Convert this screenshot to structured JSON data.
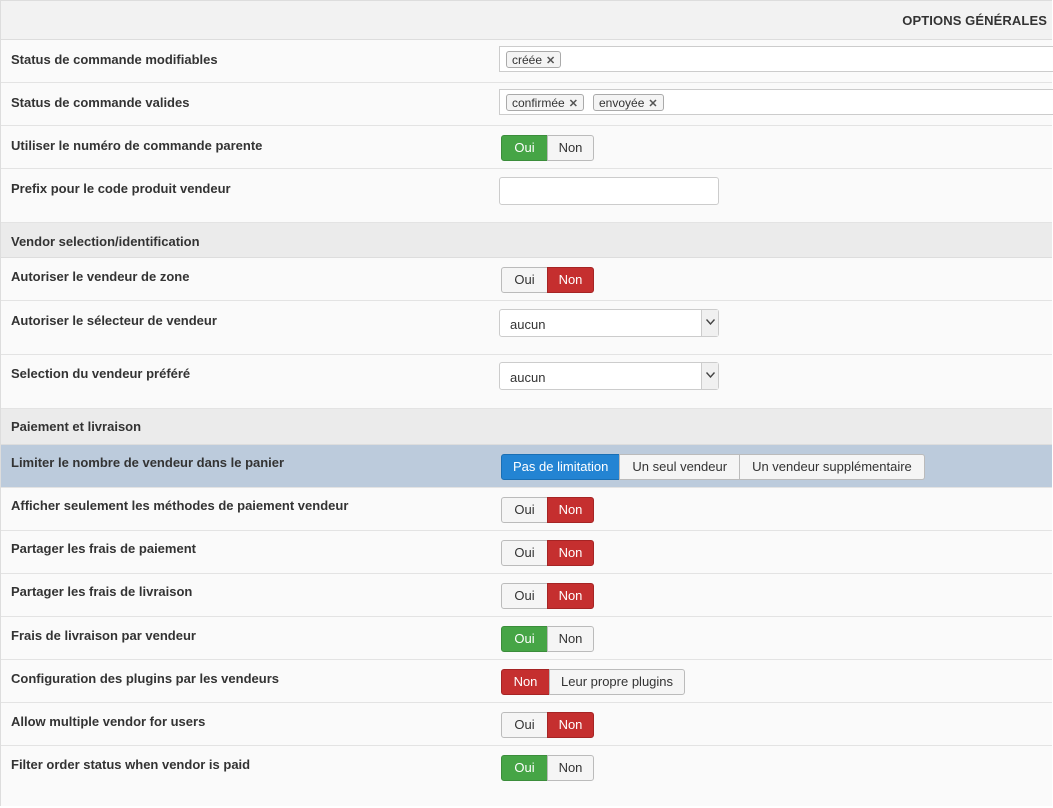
{
  "header": {
    "title": "OPTIONS GÉNÉRALES"
  },
  "rows": {
    "status_modifiables": {
      "label": "Status de commande modifiables",
      "tags": [
        "créée"
      ]
    },
    "status_valides": {
      "label": "Status de commande valides",
      "tags": [
        "confirmée",
        "envoyée"
      ]
    },
    "numero_parente": {
      "label": "Utiliser le numéro de commande parente",
      "oui": "Oui",
      "non": "Non",
      "selected": "Oui"
    },
    "prefix": {
      "label": "Prefix pour le code produit vendeur",
      "value": ""
    },
    "section_vendor": {
      "label": "Vendor selection/identification"
    },
    "vendeur_zone": {
      "label": "Autoriser le vendeur de zone",
      "oui": "Oui",
      "non": "Non",
      "selected": "Non"
    },
    "selecteur_vendeur": {
      "label": "Autoriser le sélecteur de vendeur",
      "value": "aucun"
    },
    "vendeur_prefere": {
      "label": "Selection du vendeur préféré",
      "value": "aucun"
    },
    "section_paiement": {
      "label": "Paiement et livraison"
    },
    "limiter": {
      "label": "Limiter le nombre de vendeur dans le panier",
      "options": [
        "Pas de limitation",
        "Un seul vendeur",
        "Un vendeur supplémentaire"
      ],
      "selected": "Pas de limitation"
    },
    "methodes_paiement": {
      "label": "Afficher seulement les méthodes de paiement vendeur",
      "oui": "Oui",
      "non": "Non",
      "selected": "Non"
    },
    "frais_paiement": {
      "label": "Partager les frais de paiement",
      "oui": "Oui",
      "non": "Non",
      "selected": "Non"
    },
    "frais_livraison": {
      "label": "Partager les frais de livraison",
      "oui": "Oui",
      "non": "Non",
      "selected": "Non"
    },
    "livraison_par_vendeur": {
      "label": "Frais de livraison par vendeur",
      "oui": "Oui",
      "non": "Non",
      "selected": "Oui"
    },
    "config_plugins": {
      "label": "Configuration des plugins par les vendeurs",
      "options": [
        "Non",
        "Leur propre plugins"
      ],
      "selected": "Non"
    },
    "multiple_vendor": {
      "label": "Allow multiple vendor for users",
      "oui": "Oui",
      "non": "Non",
      "selected": "Non"
    },
    "filter_status": {
      "label": "Filter order status when vendor is paid",
      "oui": "Oui",
      "non": "Non",
      "selected": "Oui"
    }
  },
  "colors": {
    "oui_active": "#46a546",
    "non_active": "#c52f2f",
    "blue_active": "#2384d3",
    "highlight_row": "#bccbdc"
  },
  "icons": {
    "tag_remove": "close-icon",
    "select_arrow": "chevron-down-icon"
  }
}
